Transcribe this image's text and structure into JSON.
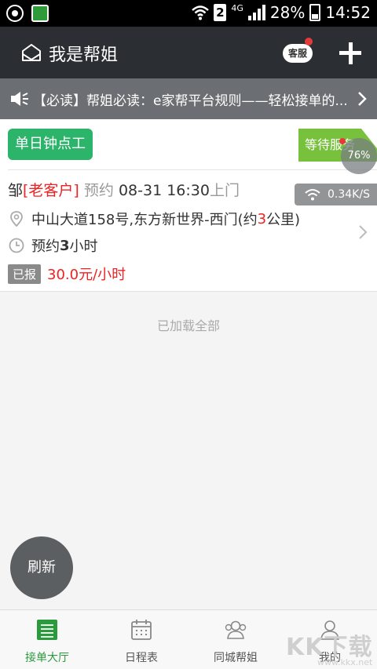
{
  "status_bar": {
    "battery": "28%",
    "time": "14:52",
    "sim": "2",
    "network": "4G"
  },
  "header": {
    "title": "我是帮姐",
    "service_label": "客服"
  },
  "notice": {
    "text": "【必读】帮姐必读：e家帮平台规则——轻松接单的..."
  },
  "order": {
    "type_tag": "单日钟点工",
    "status_tag": "等待服务",
    "surname": "邹",
    "customer_tag": "[老客户]",
    "appt_prefix": "预约",
    "appt_time": "08-31 16:30",
    "appt_suffix": "上门",
    "address": "中山大道158号,东方新世界-西门(约",
    "distance_value": "3",
    "distance_suffix": "公里)",
    "duration_prefix": "预约",
    "duration_value": "3",
    "duration_suffix": "小时",
    "quoted_label": "已报",
    "price": "30.0元/小时"
  },
  "overlay": {
    "speed": "0.34K/S",
    "memory": "76%"
  },
  "list_footer": "已加载全部",
  "refresh_label": "刷新",
  "bottom_nav": [
    {
      "label": "接单大厅",
      "icon": "list-icon",
      "active": true
    },
    {
      "label": "日程表",
      "icon": "calendar-icon",
      "active": false
    },
    {
      "label": "同城帮姐",
      "icon": "people-icon",
      "active": false
    },
    {
      "label": "我的",
      "icon": "profile-icon",
      "active": false
    }
  ],
  "watermark": {
    "text": "KK下载",
    "url": "www.kkx.net"
  },
  "colors": {
    "accent_green": "#2bb46a",
    "status_green": "#78c13d",
    "price_red": "#e22222",
    "header_dark": "#2b2f33"
  }
}
